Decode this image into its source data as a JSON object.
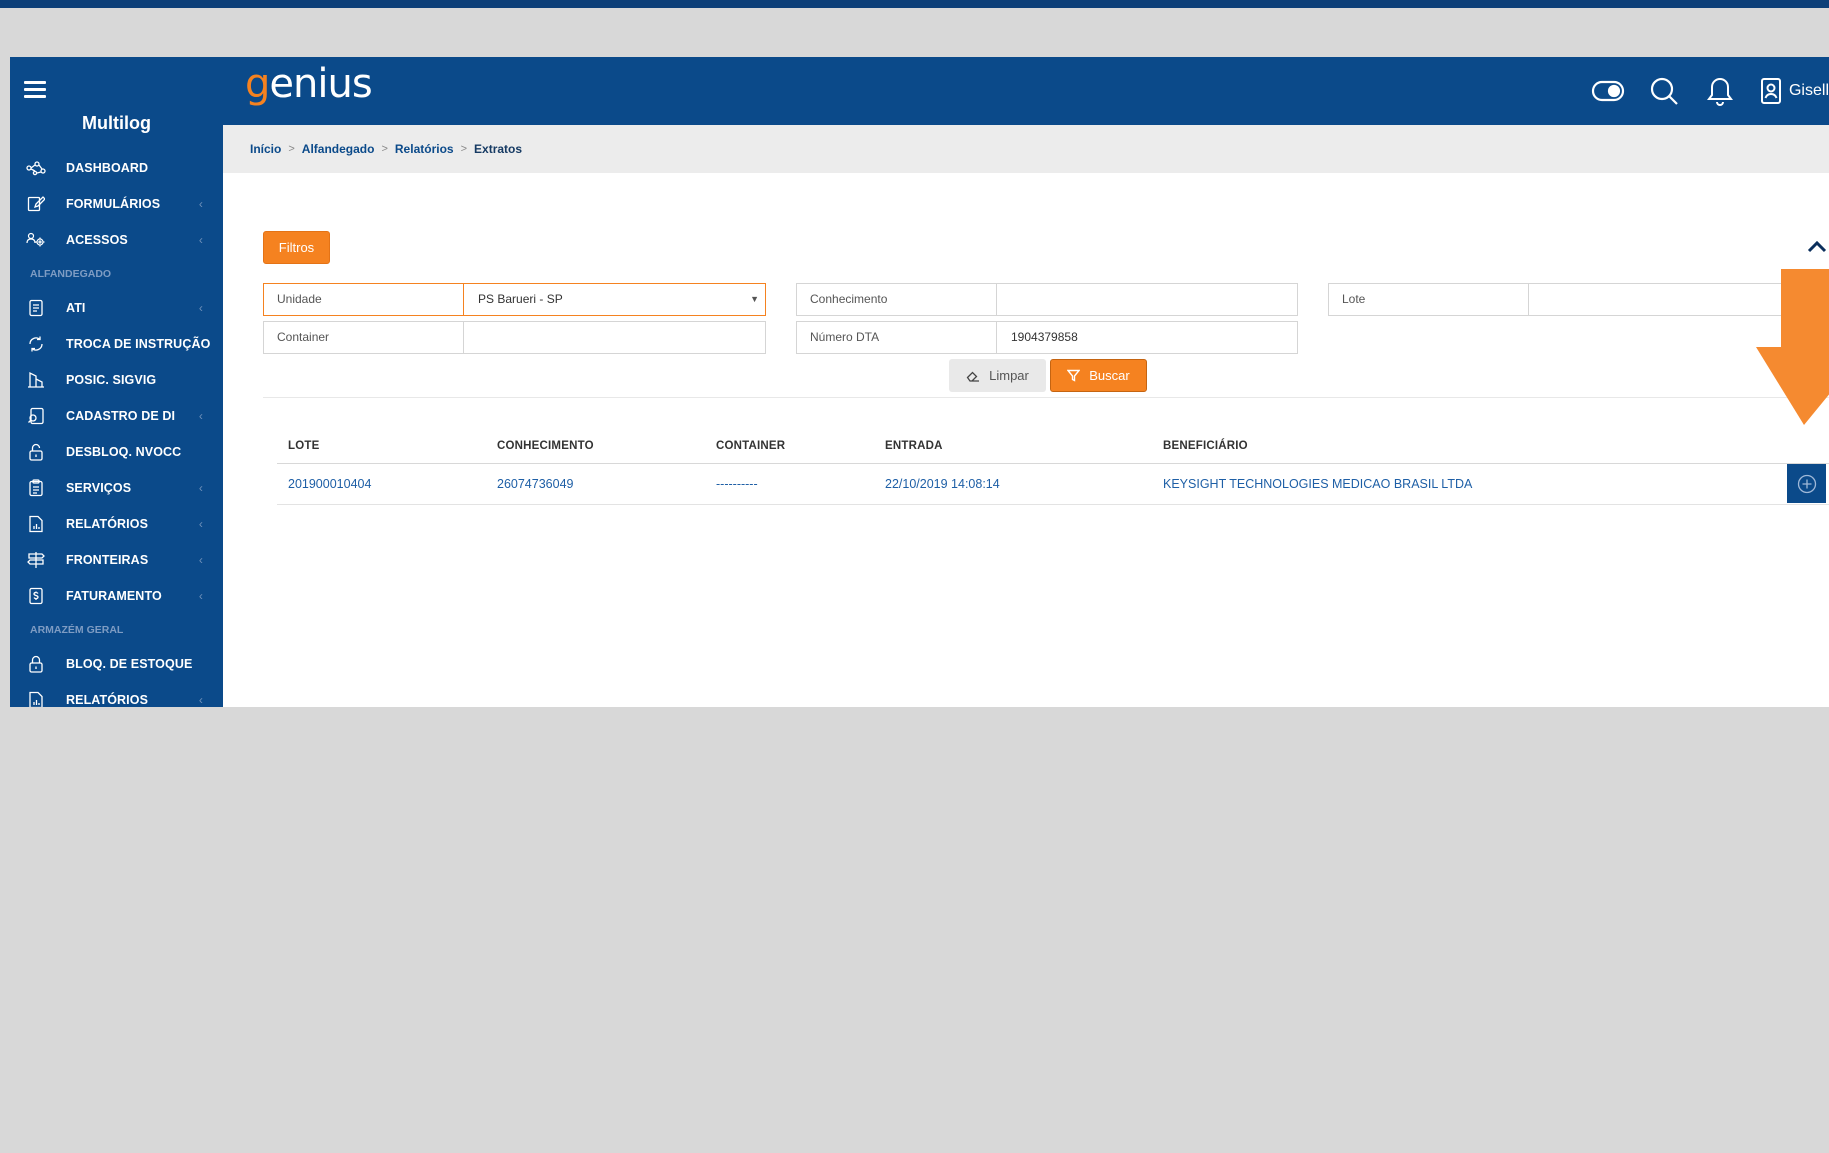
{
  "app": {
    "brand": "Multilog",
    "logo_prefix": "g",
    "logo_rest": "enius",
    "user_name": "Gisell"
  },
  "sidebar": {
    "items": [
      {
        "label": "DASHBOARD",
        "icon": "network-icon",
        "has_children": false
      },
      {
        "label": "FORMULÁRIOS",
        "icon": "edit-form-icon",
        "has_children": true
      },
      {
        "label": "ACESSOS",
        "icon": "users-gear-icon",
        "has_children": true
      }
    ],
    "section_alfandegado": "ALFANDEGADO",
    "alfandegado_items": [
      {
        "label": "ATI",
        "icon": "document-icon",
        "has_children": true
      },
      {
        "label": "TROCA DE INSTRUÇÃO",
        "icon": "refresh-icon",
        "has_children": false
      },
      {
        "label": "POSIC. SIGVIG",
        "icon": "building-icon",
        "has_children": false
      },
      {
        "label": "CADASTRO DE DI",
        "icon": "document-search-icon",
        "has_children": true
      },
      {
        "label": "DESBLOQ. NVOCC",
        "icon": "unlock-icon",
        "has_children": false
      },
      {
        "label": "SERVIÇOS",
        "icon": "clipboard-icon",
        "has_children": true
      },
      {
        "label": "RELATÓRIOS",
        "icon": "report-icon",
        "has_children": true
      },
      {
        "label": "FRONTEIRAS",
        "icon": "signpost-icon",
        "has_children": true
      },
      {
        "label": "FATURAMENTO",
        "icon": "invoice-icon",
        "has_children": true
      }
    ],
    "section_armazem": "ARMAZÉM GERAL",
    "armazem_items": [
      {
        "label": "BLOQ. DE ESTOQUE",
        "icon": "lock-icon",
        "has_children": false
      },
      {
        "label": "RELATÓRIOS",
        "icon": "report-icon",
        "has_children": true
      }
    ]
  },
  "breadcrumb": {
    "items": [
      "Início",
      "Alfandegado",
      "Relatórios"
    ],
    "current": "Extratos"
  },
  "filters": {
    "toggle_label": "Filtros",
    "unidade": {
      "label": "Unidade",
      "value": "PS Barueri - SP"
    },
    "conhecimento": {
      "label": "Conhecimento",
      "value": ""
    },
    "lote": {
      "label": "Lote",
      "value": ""
    },
    "container": {
      "label": "Container",
      "value": ""
    },
    "numero_dta": {
      "label": "Número DTA",
      "value": "1904379858"
    },
    "clear_label": "Limpar",
    "search_label": "Buscar"
  },
  "table": {
    "headers": [
      "LOTE",
      "CONHECIMENTO",
      "CONTAINER",
      "ENTRADA",
      "BENEFICIÁRIO"
    ],
    "rows": [
      {
        "lote": "201900010404",
        "conhecimento": "26074736049",
        "container": "----------",
        "entrada": "22/10/2019 14:08:14",
        "beneficiario": "KEYSIGHT TECHNOLOGIES MEDICAO BRASIL LTDA"
      }
    ]
  },
  "colors": {
    "primary": "#0b4a8a",
    "accent": "#f58220",
    "annotation_arrow": "#f58a30"
  }
}
